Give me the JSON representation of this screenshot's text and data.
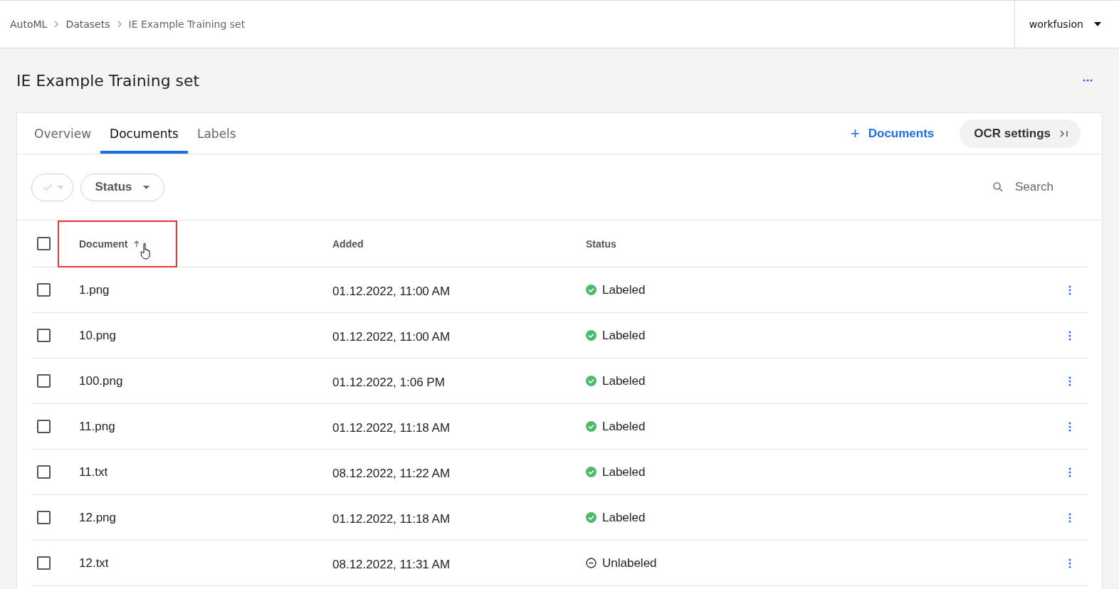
{
  "breadcrumbs": [
    "AutoML",
    "Datasets",
    "IE Example Training set"
  ],
  "user": {
    "name": "workfusion"
  },
  "page": {
    "title": "IE Example Training set"
  },
  "tabs": [
    {
      "label": "Overview",
      "selected": false
    },
    {
      "label": "Documents",
      "selected": true
    },
    {
      "label": "Labels",
      "selected": false
    }
  ],
  "actions": {
    "add": {
      "icon": "+",
      "label": "Documents"
    },
    "ocr": {
      "label": "OCR settings"
    }
  },
  "filters": {
    "status": {
      "label": "Status"
    },
    "search": {
      "placeholder": "Search"
    }
  },
  "table": {
    "select_all": {
      "checked": false
    },
    "columns": [
      {
        "label": "Document",
        "sorted": true,
        "highlighted": true
      },
      {
        "label": "Added"
      },
      {
        "label": "Status"
      }
    ],
    "rows": [
      {
        "document": "1.png",
        "added": "01.12.2022, 11:00 AM",
        "status": "Labeled",
        "kind": "labeled",
        "checked": false
      },
      {
        "document": "10.png",
        "added": "01.12.2022, 11:00 AM",
        "status": "Labeled",
        "kind": "labeled",
        "checked": false
      },
      {
        "document": "100.png",
        "added": "01.12.2022, 1:06 PM",
        "status": "Labeled",
        "kind": "labeled",
        "checked": false
      },
      {
        "document": "11.png",
        "added": "01.12.2022, 11:18 AM",
        "status": "Labeled",
        "kind": "labeled",
        "checked": false
      },
      {
        "document": "11.txt",
        "added": "08.12.2022, 11:22 AM",
        "status": "Labeled",
        "kind": "labeled",
        "checked": false
      },
      {
        "document": "12.png",
        "added": "01.12.2022, 11:18 AM",
        "status": "Labeled",
        "kind": "labeled",
        "checked": false
      },
      {
        "document": "12.txt",
        "added": "08.12.2022, 11:31 AM",
        "status": "Unlabeled",
        "kind": "unlabeled",
        "checked": false
      }
    ]
  }
}
